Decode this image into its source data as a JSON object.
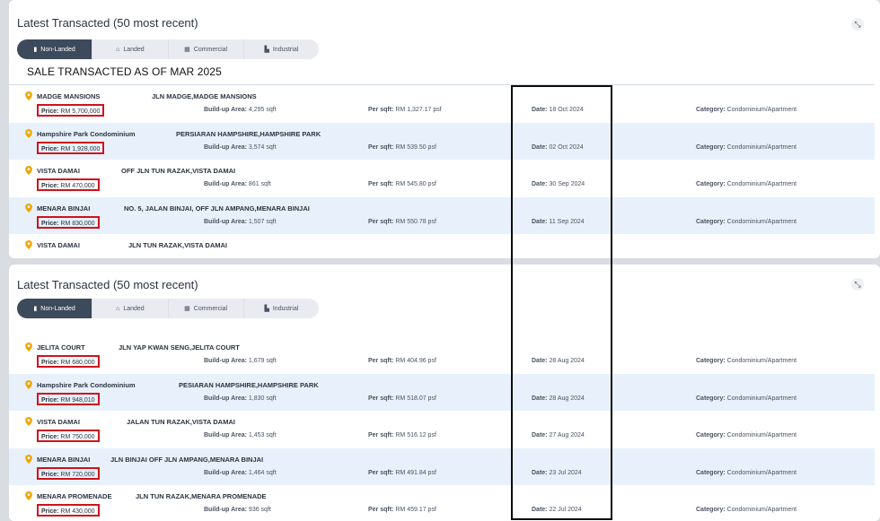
{
  "colors": {
    "accent_tab": "#3d4a5c",
    "row_alt": "#e8f1fb",
    "price_box": "#d0121b",
    "pin": "#f0a500"
  },
  "icons": {
    "location": "map-pin-icon",
    "collapse": "collapse-icon",
    "non_landed": "bookmark-icon",
    "landed": "house-icon",
    "commercial": "grid-icon",
    "industrial": "factory-icon"
  },
  "panel1": {
    "title": "Latest Transacted (50 most recent)",
    "subtitle": "SALE TRANSACTED AS OF MAR 2025",
    "tabs": [
      "Non-Landed",
      "Landed",
      "Commercial",
      "Industrial"
    ],
    "rows": [
      {
        "name": "MADGE MANSIONS",
        "addr": "JLN MADGE,MADGE MANSIONS",
        "price": "RM 5,700,000",
        "build": "4,295 sqft",
        "psf": "RM 1,327.17 psf",
        "date": "18 Oct 2024",
        "category": "Condominium/Apartment"
      },
      {
        "name": "Hampshire Park Condominium",
        "addr": "PERSIARAN HAMPSHIRE,HAMPSHIRE PARK",
        "price": "RM 1,928,000",
        "build": "3,574 sqft",
        "psf": "RM 539.50 psf",
        "date": "02 Oct 2024",
        "category": "Condominium/Apartment"
      },
      {
        "name": "VISTA DAMAI",
        "addr": "OFF JLN TUN RAZAK,VISTA DAMAI",
        "price": "RM 470,000",
        "build": "861 sqft",
        "psf": "RM 545.80 psf",
        "date": "30 Sep 2024",
        "category": "Condominium/Apartment"
      },
      {
        "name": "MENARA BINJAI",
        "addr": "NO. 5, JALAN BINJAI, OFF JLN AMPANG,MENARA BINJAI",
        "price": "RM 830,000",
        "build": "1,507 sqft",
        "psf": "RM 550.78 psf",
        "date": "11 Sep 2024",
        "category": "Condominium/Apartment"
      },
      {
        "name": "VISTA DAMAI",
        "addr": "JLN TUN RAZAK,VISTA DAMAI"
      }
    ]
  },
  "panel2": {
    "title": "Latest Transacted (50 most recent)",
    "tabs": [
      "Non-Landed",
      "Landed",
      "Commercial",
      "Industrial"
    ],
    "rows": [
      {
        "name": "JELITA COURT",
        "addr": "JLN YAP KWAN SENG,JELITA COURT",
        "price": "RM 680,000",
        "build": "1,679 sqft",
        "psf": "RM 404.96 psf",
        "date": "28 Aug 2024",
        "category": "Condominium/Apartment"
      },
      {
        "name": "Hampshire Park Condominium",
        "addr": "PESIARAN HAMPSHIRE,HAMPSHIRE PARK",
        "price": "RM 948,010",
        "build": "1,830 sqft",
        "psf": "RM 518.07 psf",
        "date": "28 Aug 2024",
        "category": "Condominium/Apartment"
      },
      {
        "name": "VISTA DAMAI",
        "addr": "JALAN TUN RAZAK,VISTA DAMAI",
        "price": "RM 750,000",
        "build": "1,453 sqft",
        "psf": "RM 516.12 psf",
        "date": "27 Aug 2024",
        "category": "Condominium/Apartment"
      },
      {
        "name": "MENARA BINJAI",
        "addr": "JLN BINJAI OFF JLN AMPANG,MENARA BINJAI",
        "price": "RM 720,000",
        "build": "1,464 sqft",
        "psf": "RM 491.84 psf",
        "date": "23 Jul 2024",
        "category": "Condominium/Apartment"
      },
      {
        "name": "MENARA PROMENADE",
        "addr": "JLN TUN RAZAK,MENARA PROMENADE",
        "price": "RM 430,000",
        "build": "936 sqft",
        "psf": "RM 459.17 psf",
        "date": "22 Jul 2024",
        "category": "Condominium/Apartment"
      }
    ]
  },
  "labels": {
    "price": "Price:",
    "build": "Build-up Area:",
    "psf": "Per sqft:",
    "date": "Date:",
    "category": "Category:"
  }
}
